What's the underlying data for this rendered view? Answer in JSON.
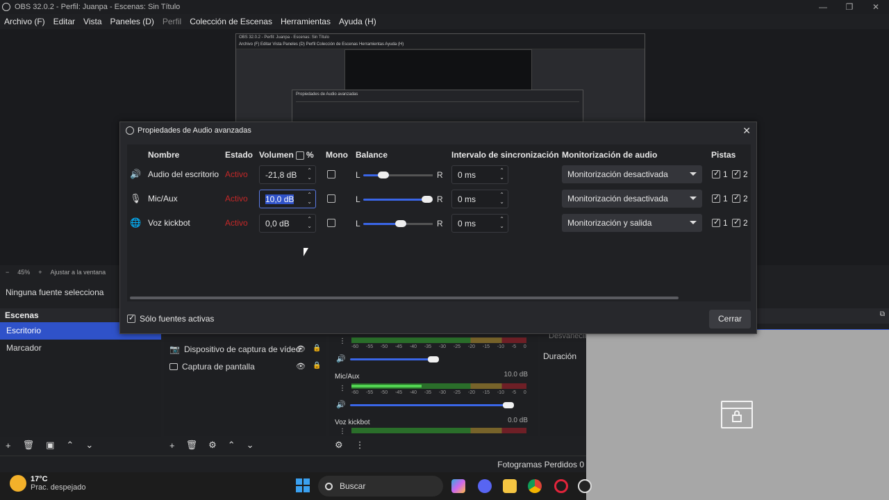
{
  "window": {
    "title": "OBS 32.0.2 - Perfil: Juanpa - Escenas: Sin Título"
  },
  "menu": {
    "items": [
      "Archivo (F)",
      "Editar",
      "Vista",
      "Paneles (D)",
      "Perfil",
      "Colección de Escenas",
      "Herramientas",
      "Ayuda (H)"
    ]
  },
  "preview": {
    "inner_title": "OBS 32.0.2 - Perfil: Juanpa - Escenas: Sin Título",
    "inner_menu": "Archivo (F)   Editar   Vista   Paneles (D)   Perfil   Colección de Escenas   Herramientas   Ayuda (H)",
    "inner_dialog_title": "Propiedades de Audio avanzadas"
  },
  "zoom": {
    "minus": "−",
    "percent": "45%",
    "plus": "+",
    "fit": "Ajustar a la ventana"
  },
  "source_status": "Ninguna fuente selecciona",
  "scenes": {
    "title": "Escenas",
    "items": [
      "Escritorio",
      "Marcador"
    ],
    "selected": "Escritorio"
  },
  "sources": {
    "items": [
      "Dispositivo de captura de vídeo",
      "Captura de pantalla"
    ]
  },
  "mixer": {
    "channels": [
      {
        "name": "",
        "db": "",
        "level": 0.0,
        "volume": 0.5
      },
      {
        "name": "Mic/Aux",
        "db": "10.0 dB",
        "level": 0.4,
        "volume": 1.0
      },
      {
        "name": "Voz kickbot",
        "db": "0.0 dB",
        "level": 0.0,
        "volume": 0.5
      }
    ],
    "scale": [
      "-60",
      "-55",
      "-50",
      "-45",
      "-40",
      "-35",
      "-30",
      "-25",
      "-20",
      "-15",
      "-10",
      "-5",
      "0"
    ]
  },
  "transitions": {
    "duration_label": "Duración",
    "fade_label": "Desvanecim"
  },
  "status": {
    "dropped_frames": "Fotogramas Perdidos 0"
  },
  "taskbar": {
    "temperature": "17°C",
    "weather": "Prac. despejado",
    "search": "Buscar"
  },
  "dialog": {
    "title": "Propiedades de Audio avanzadas",
    "headers": {
      "name": "Nombre",
      "state": "Estado",
      "volume": "Volumen",
      "percent": "%",
      "mono": "Mono",
      "balance": "Balance",
      "sync": "Intervalo de sincronización",
      "monitoring": "Monitorización de audio",
      "tracks": "Pistas"
    },
    "rows": [
      {
        "icon": "speaker-icon",
        "name": "Audio del escritorio",
        "state": "Activo",
        "volume": "-21,8 dB",
        "mono": false,
        "balance": 0.25,
        "sync": "0 ms",
        "monitoring": "Monitorización desactivada",
        "track1": "1",
        "track2": "2"
      },
      {
        "icon": "microphone-icon",
        "name": "Mic/Aux",
        "state": "Activo",
        "volume": "10,0 dB",
        "mono": false,
        "balance": 1.0,
        "sync": "0 ms",
        "monitoring": "Monitorización desactivada",
        "track1": "1",
        "track2": "2"
      },
      {
        "icon": "globe-icon",
        "name": "Voz kickbot",
        "state": "Activo",
        "volume": "0,0 dB",
        "mono": false,
        "balance": 0.55,
        "sync": "0 ms",
        "monitoring": "Monitorización y salida",
        "track1": "1",
        "track2": "2"
      }
    ],
    "only_active": "Sólo fuentes activas",
    "close": "Cerrar"
  },
  "colors": {
    "accent": "#2f52c9",
    "state_red": "#c62828",
    "background": "#1f2023"
  }
}
